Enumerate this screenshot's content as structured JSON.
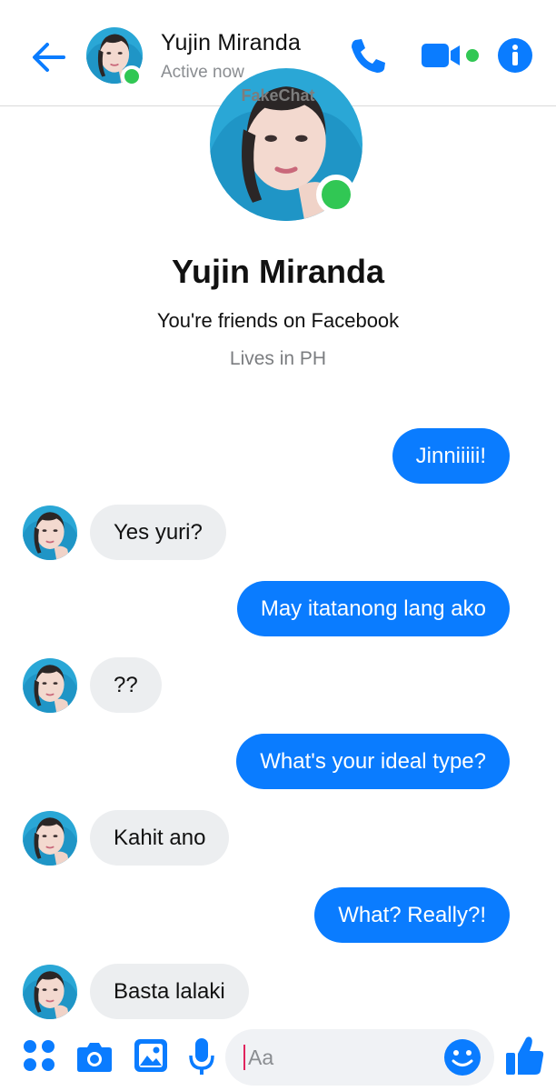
{
  "header": {
    "contact_name": "Yujin Miranda",
    "status": "Active now",
    "watermark": "FakeChat",
    "icons": [
      "back-arrow-icon",
      "phone-icon",
      "video-camera-icon",
      "info-icon"
    ]
  },
  "profile": {
    "name": "Yujin Miranda",
    "friends_line": "You're friends on Facebook",
    "lives_line": "Lives in PH"
  },
  "messages": [
    {
      "from": "me",
      "text": "Jinniiiii!"
    },
    {
      "from": "them",
      "text": "Yes yuri?"
    },
    {
      "from": "me",
      "text": "May itatanong lang ako"
    },
    {
      "from": "them",
      "text": "??"
    },
    {
      "from": "me",
      "text": "What's your ideal type?"
    },
    {
      "from": "them",
      "text": "Kahit ano"
    },
    {
      "from": "me",
      "text": "What? Really?!"
    },
    {
      "from": "them",
      "text": "Basta lalaki"
    }
  ],
  "composer": {
    "placeholder": "Aa",
    "icons": [
      "menu-dots-icon",
      "camera-icon",
      "gallery-icon",
      "microphone-icon",
      "emoji-icon",
      "thumbs-up-icon"
    ]
  },
  "colors": {
    "accent": "#0a7cff",
    "online": "#31c754",
    "incoming_bubble": "#eceef0",
    "avatar_hood": "#2aa7d6"
  }
}
